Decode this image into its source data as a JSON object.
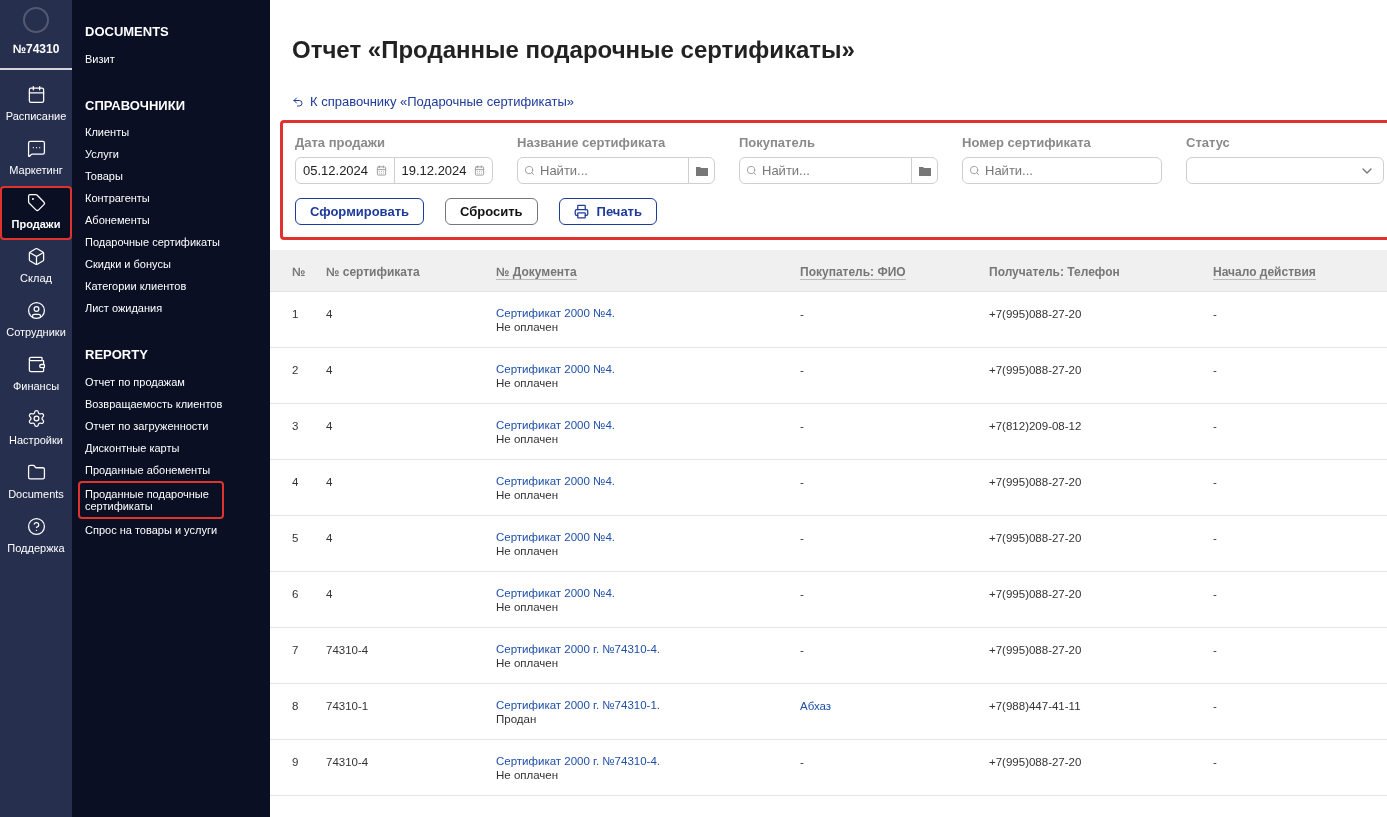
{
  "account": {
    "number": "№74310"
  },
  "nav": [
    {
      "label": "Расписание",
      "kind": "calendar",
      "selected": false,
      "highlighted": false
    },
    {
      "label": "Маркетинг",
      "kind": "chat",
      "selected": false,
      "highlighted": false
    },
    {
      "label": "Продажи",
      "kind": "tag",
      "selected": true,
      "highlighted": true
    },
    {
      "label": "Склад",
      "kind": "box",
      "selected": false,
      "highlighted": false
    },
    {
      "label": "Сотрудники",
      "kind": "user",
      "selected": false,
      "highlighted": false
    },
    {
      "label": "Финансы",
      "kind": "wallet",
      "selected": false,
      "highlighted": false
    },
    {
      "label": "Настройки",
      "kind": "gear",
      "selected": false,
      "highlighted": false
    },
    {
      "label": "Documents",
      "kind": "folder",
      "selected": false,
      "highlighted": false
    },
    {
      "label": "Поддержка",
      "kind": "help",
      "selected": false,
      "highlighted": false
    }
  ],
  "menu": [
    {
      "title": "DOCUMENTS",
      "items": [
        {
          "label": "Визит",
          "selected": false
        }
      ]
    },
    {
      "title": "СПРАВОЧНИКИ",
      "items": [
        {
          "label": "Клиенты",
          "selected": false
        },
        {
          "label": "Услуги",
          "selected": false
        },
        {
          "label": "Товары",
          "selected": false
        },
        {
          "label": "Контрагенты",
          "selected": false
        },
        {
          "label": "Абонементы",
          "selected": false
        },
        {
          "label": "Подарочные сертификаты",
          "selected": false
        },
        {
          "label": "Скидки и бонусы",
          "selected": false
        },
        {
          "label": "Категории клиентов",
          "selected": false
        },
        {
          "label": "Лист ожидания",
          "selected": false
        }
      ]
    },
    {
      "title": "REPORTY",
      "items": [
        {
          "label": "Отчет по продажам",
          "selected": false
        },
        {
          "label": "Возвращаемость клиентов",
          "selected": false
        },
        {
          "label": "Отчет по загруженности",
          "selected": false
        },
        {
          "label": "Дисконтные карты",
          "selected": false
        },
        {
          "label": "Проданные абонементы",
          "selected": false
        },
        {
          "label": "Проданные подарочные сертификаты",
          "selected": true
        },
        {
          "label": "Спрос на товары и услуги",
          "selected": false
        }
      ]
    }
  ],
  "page": {
    "title": "Отчет «Проданные подарочные сертификаты»",
    "back_link": "К справочнику «Подарочные сертификаты»"
  },
  "filters": {
    "highlighted": true,
    "date": {
      "label": "Дата продажи",
      "from": "05.12.2024",
      "to": "19.12.2024"
    },
    "fields": [
      {
        "label": "Название сертификата",
        "placeholder": "Найти...",
        "kind": "lookup"
      },
      {
        "label": "Покупатель",
        "placeholder": "Найти...",
        "kind": "lookup"
      },
      {
        "label": "Номер сертификата",
        "placeholder": "Найти...",
        "kind": "search"
      },
      {
        "label": "Статус",
        "kind": "select"
      }
    ],
    "buttons": [
      {
        "label": "Сформировать",
        "kind": "primary"
      },
      {
        "label": "Сбросить",
        "kind": "secondary"
      },
      {
        "label": "Печать",
        "kind": "print"
      }
    ]
  },
  "table": {
    "columns": [
      {
        "label": "№",
        "sortable": false
      },
      {
        "label": "№ сертификата",
        "sortable": false
      },
      {
        "label": "№ Документа",
        "sortable": true
      },
      {
        "label": "Покупатель: ФИО",
        "sortable": true
      },
      {
        "label": "Получатель: Телефон",
        "sortable": false
      },
      {
        "label": "Начало действия",
        "sortable": true
      }
    ],
    "rows": [
      {
        "n": "1",
        "cert": "4",
        "doc": "Сертификат 2000 №4.",
        "status": "Не оплачен",
        "buyer": "-",
        "buyer_link": false,
        "phone": "+7(995)088-27-20",
        "start": "-"
      },
      {
        "n": "2",
        "cert": "4",
        "doc": "Сертификат 2000 №4.",
        "status": "Не оплачен",
        "buyer": "-",
        "buyer_link": false,
        "phone": "+7(995)088-27-20",
        "start": "-"
      },
      {
        "n": "3",
        "cert": "4",
        "doc": "Сертификат 2000 №4.",
        "status": "Не оплачен",
        "buyer": "-",
        "buyer_link": false,
        "phone": "+7(812)209-08-12",
        "start": "-"
      },
      {
        "n": "4",
        "cert": "4",
        "doc": "Сертификат 2000 №4.",
        "status": "Не оплачен",
        "buyer": "-",
        "buyer_link": false,
        "phone": "+7(995)088-27-20",
        "start": "-"
      },
      {
        "n": "5",
        "cert": "4",
        "doc": "Сертификат 2000 №4.",
        "status": "Не оплачен",
        "buyer": "-",
        "buyer_link": false,
        "phone": "+7(995)088-27-20",
        "start": "-"
      },
      {
        "n": "6",
        "cert": "4",
        "doc": "Сертификат 2000 №4.",
        "status": "Не оплачен",
        "buyer": "-",
        "buyer_link": false,
        "phone": "+7(995)088-27-20",
        "start": "-"
      },
      {
        "n": "7",
        "cert": "74310-4",
        "doc": "Сертификат 2000 г. №74310-4.",
        "status": "Не оплачен",
        "buyer": "-",
        "buyer_link": false,
        "phone": "+7(995)088-27-20",
        "start": "-"
      },
      {
        "n": "8",
        "cert": "74310-1",
        "doc": "Сертификат 2000 г. №74310-1.",
        "status": "Продан",
        "buyer": "Абхаз",
        "buyer_link": true,
        "phone": "+7(988)447-41-11",
        "start": "-"
      },
      {
        "n": "9",
        "cert": "74310-4",
        "doc": "Сертификат 2000 г. №74310-4.",
        "status": "Не оплачен",
        "buyer": "-",
        "buyer_link": false,
        "phone": "+7(995)088-27-20",
        "start": "-"
      }
    ]
  }
}
